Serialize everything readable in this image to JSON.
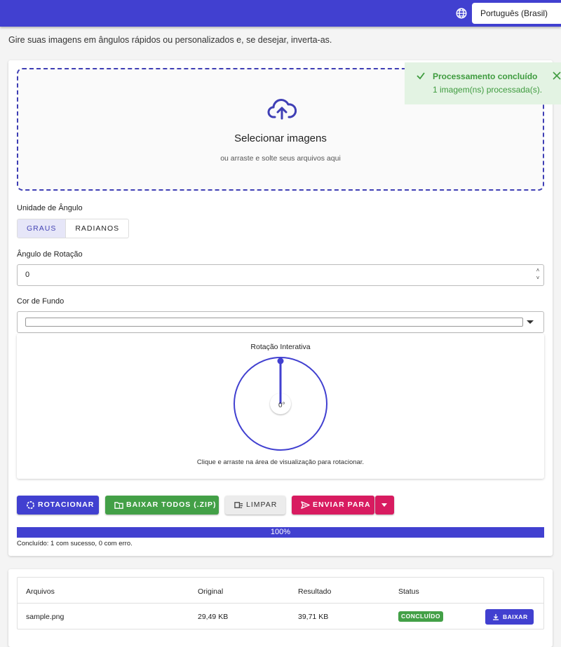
{
  "header": {
    "language": "Português (Brasil)",
    "globe_icon": "globe-icon"
  },
  "subtitle": "Gire suas imagens em ângulos rápidos ou personalizados e, se desejar, inverta-as.",
  "dropzone": {
    "title": "Selecionar imagens",
    "hint": "ou arraste e solte seus arquivos aqui",
    "icon": "cloud-upload-icon"
  },
  "toast": {
    "title": "Processamento concluído",
    "message": "1 imagem(ns) processada(s).",
    "color": "#3e9b3e"
  },
  "form": {
    "angle_unit_label": "Unidade de Ângulo",
    "unit_options": [
      "GRAUS",
      "RADIANOS"
    ],
    "selected_unit": "GRAUS",
    "rotation_label": "Ângulo de Rotação",
    "rotation_value": "0",
    "background_label": "Cor de Fundo",
    "background_color": "#ffffff"
  },
  "preview": {
    "title": "Rotação Interativa",
    "angle_display": "0°",
    "angle_value": 0,
    "hint": "Clique e arraste na área de visualização para rotacionar."
  },
  "actions": {
    "rotate": "ROTACIONAR",
    "download_all": "BAIXAR TODOS (.ZIP)",
    "clear": "LIMPAR",
    "send_to": "ENVIAR PARA"
  },
  "progress": {
    "percent_label": "100%",
    "value": 1.0,
    "summary": "Concluído: 1 com sucesso, 0 com erro."
  },
  "table": {
    "headers": [
      "Arquivos",
      "Original",
      "Resultado",
      "Status"
    ],
    "rows": [
      {
        "file": "sample.png",
        "original": "29,49 KB",
        "result": "39,71 KB",
        "status": "CONCLUÍDO",
        "action": "BAIXAR"
      }
    ]
  },
  "colors": {
    "primary": "#4140d0",
    "success": "#43a047",
    "accent": "#d81b60"
  }
}
